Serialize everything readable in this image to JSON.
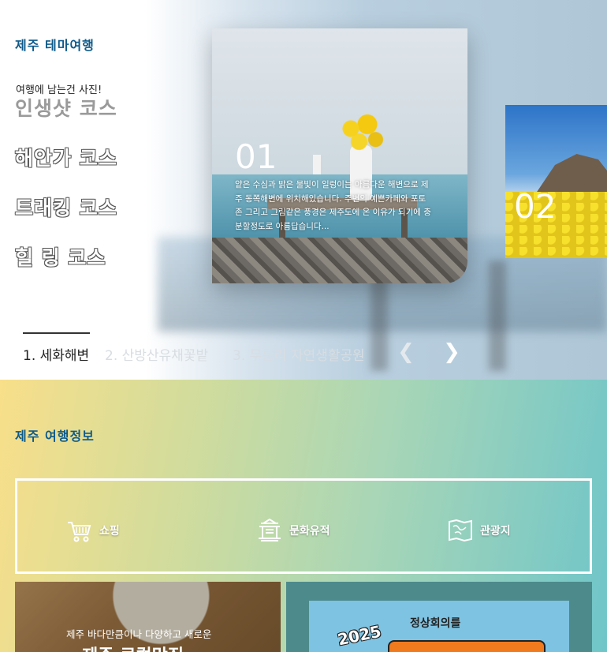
{
  "theme": {
    "title": "제주  테마여행",
    "subtitle": "여행에 남는건 사진!",
    "courses": [
      "인생샷 코스",
      "해안가 코스",
      "트래킹 코스",
      "힐 링 코스"
    ]
  },
  "slider": {
    "main": {
      "number": "01",
      "description": "얕은 수심과 밝은 물빛이 일렁이는 아름다운 해변으로 제주 동쪽해변에 위치해있습니다. 주변의 예쁜카페와 포토존 그리고 그림같은 풍경은 제주도에 온 이유가 되기에 충분할정도로 아름답습니다..."
    },
    "next": {
      "number": "02"
    },
    "tabs": [
      "1. 세화해변",
      "2. 산방산유채꽃밭",
      "3. 무릉리 자연생활공원"
    ],
    "prev_icon": "chevron-left-icon",
    "next_icon": "chevron-right-icon"
  },
  "info": {
    "title": "제주  여행정보",
    "categories": [
      {
        "label": "쇼핑",
        "icon": "cart-icon"
      },
      {
        "label": "문화유적",
        "icon": "heritage-icon"
      },
      {
        "label": "관광지",
        "icon": "map-icon"
      }
    ],
    "food_card": {
      "subtitle": "제주 바다만큼이나 다양하고 새로운",
      "title": "제주 로컬맛집"
    },
    "poster_card": {
      "small_text": "정상회의를",
      "year": "2025"
    }
  }
}
